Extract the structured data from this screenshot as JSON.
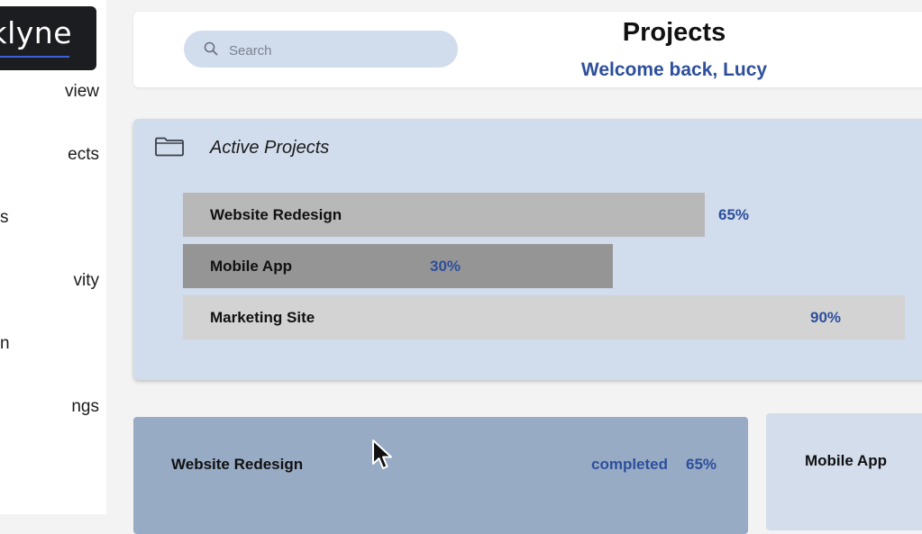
{
  "logo": {
    "text": "klyne"
  },
  "sidebar": {
    "items": [
      {
        "label": "view",
        "name": "overview"
      },
      {
        "label": "ects",
        "name": "projects"
      },
      {
        "label": "s",
        "name": "item-3"
      },
      {
        "label": "vity",
        "name": "activity"
      },
      {
        "label": "n",
        "name": "item-5"
      },
      {
        "label": "ngs",
        "name": "settings"
      }
    ]
  },
  "header": {
    "search_placeholder": "Search",
    "title": "Projects",
    "welcome": "Welcome back, Lucy"
  },
  "active_projects": {
    "title": "Active Projects",
    "projects": [
      {
        "name": "Website Redesign",
        "progress": 65,
        "progress_label": "65%",
        "color": "#b8b8b8"
      },
      {
        "name": "Mobile App",
        "progress": 30,
        "progress_label": "30%",
        "color": "#959595"
      },
      {
        "name": "Marketing Site",
        "progress": 90,
        "progress_label": "90%",
        "color": "#d3d3d3"
      }
    ]
  },
  "cards": [
    {
      "name": "Website Redesign",
      "status": "completed",
      "progress_label": "65%"
    },
    {
      "name": "Mobile App"
    }
  ],
  "colors": {
    "accent": "#2d4f9c",
    "panel_bg": "#d1dcec",
    "card_selected": "#98abc5",
    "search_bg": "#d1dced"
  }
}
